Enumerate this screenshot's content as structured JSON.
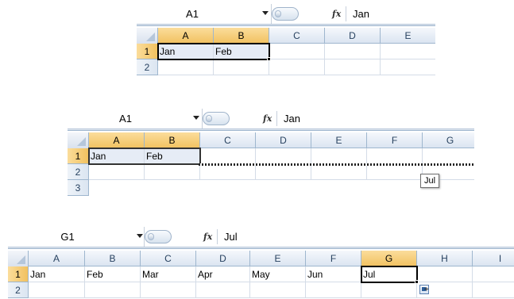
{
  "colors": {
    "selected_header": "#f1c15f",
    "header": "#dbe5f1",
    "grid_line": "#d4dce7",
    "selection_fill": "#e6ecf6"
  },
  "icons": {
    "namebox_dropdown": "chevron-down-icon",
    "formula_zoom": "circle-knob-icon",
    "function": "fx-icon",
    "autofill_options": "autofill-options-icon"
  },
  "panels": [
    {
      "name_box": "A1",
      "fx_label": "fx",
      "formula": "Jan",
      "columns": [
        "A",
        "B",
        "C",
        "D",
        "E"
      ],
      "rows": [
        "1",
        "2"
      ],
      "cells": {
        "A1": "Jan",
        "B1": "Feb"
      }
    },
    {
      "name_box": "A1",
      "fx_label": "fx",
      "formula": "Jan",
      "columns": [
        "A",
        "B",
        "C",
        "D",
        "E",
        "F",
        "G"
      ],
      "rows": [
        "1",
        "2",
        "3"
      ],
      "cells": {
        "A1": "Jan",
        "B1": "Feb"
      },
      "tooltip": "Jul"
    },
    {
      "name_box": "G1",
      "fx_label": "fx",
      "formula": "Jul",
      "columns": [
        "A",
        "B",
        "C",
        "D",
        "E",
        "F",
        "G",
        "H",
        "I"
      ],
      "rows": [
        "1",
        "2"
      ],
      "cells": {
        "A1": "Jan",
        "B1": "Feb",
        "C1": "Mar",
        "D1": "Apr",
        "E1": "May",
        "F1": "Jun",
        "G1": "Jul"
      }
    }
  ]
}
